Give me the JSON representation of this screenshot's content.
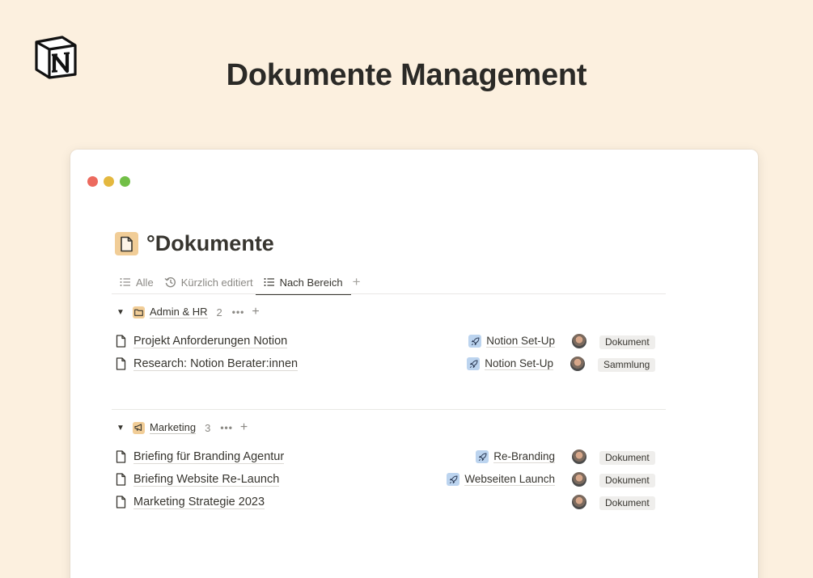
{
  "hero": {
    "title": "Dokumente Management"
  },
  "page": {
    "title": "°Dokumente"
  },
  "tabs": [
    {
      "label": "Alle",
      "icon": "list-icon"
    },
    {
      "label": "Kürzlich editiert",
      "icon": "history-icon"
    },
    {
      "label": "Nach Bereich",
      "icon": "list-icon",
      "active": true
    }
  ],
  "groups": [
    {
      "name": "Admin & HR",
      "count": "2",
      "icon": "folder-icon",
      "rows": [
        {
          "title": "Projekt Anforderungen Notion",
          "relation": "Notion Set-Up",
          "tag": "Dokument"
        },
        {
          "title": "Research: Notion Berater:innen",
          "relation": "Notion Set-Up",
          "tag": "Sammlung"
        }
      ]
    },
    {
      "name": "Marketing",
      "count": "3",
      "icon": "megaphone-icon",
      "rows": [
        {
          "title": "Briefing für Branding Agentur",
          "relation": "Re-Branding",
          "tag": "Dokument"
        },
        {
          "title": "Briefing Website Re-Launch",
          "relation": "Webseiten Launch",
          "tag": "Dokument"
        },
        {
          "title": "Marketing Strategie 2023",
          "relation": "",
          "tag": "Dokument"
        }
      ]
    }
  ],
  "colors": {
    "background": "#fcf0df",
    "accent_icon_bg": "#f1cd97",
    "relation_icon_bg": "#bcd4ef",
    "traffic_red": "#ec6a5e",
    "traffic_yellow": "#e4b83f",
    "traffic_green": "#72bf47"
  }
}
